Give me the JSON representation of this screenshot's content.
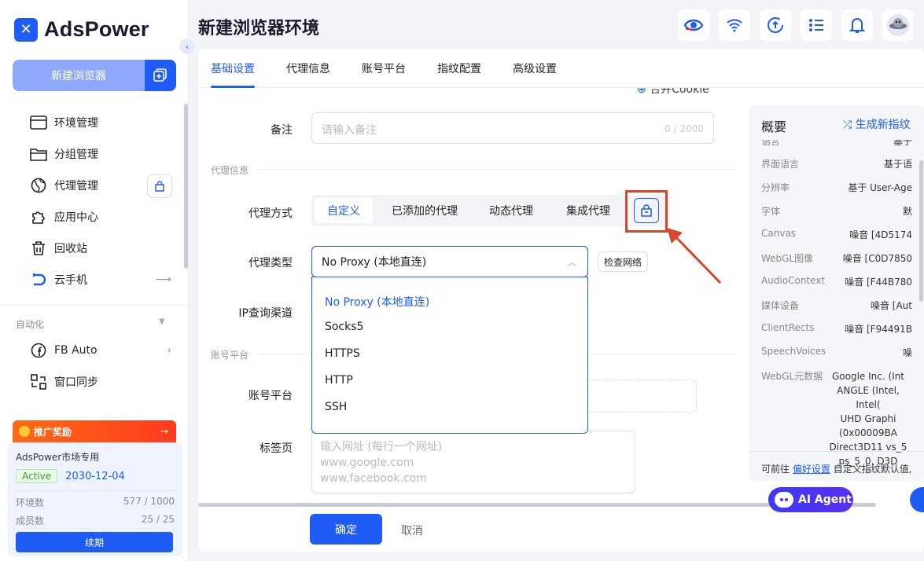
{
  "app": {
    "name": "AdsPower",
    "logo_letter": "✕"
  },
  "sidebar": {
    "new_browser_label": "新建浏览器",
    "items": [
      {
        "label": "环境管理",
        "icon": "browser-window-icon"
      },
      {
        "label": "分组管理",
        "icon": "folder-icon"
      },
      {
        "label": "代理管理",
        "icon": "globe-icon"
      },
      {
        "label": "应用中心",
        "icon": "puzzle-icon"
      },
      {
        "label": "回收站",
        "icon": "trash-icon"
      },
      {
        "label": "云手机",
        "icon": "cloud-phone-icon"
      }
    ],
    "automation_label": "自动化",
    "automation_items": [
      {
        "label": "FB Auto",
        "icon": "facebook-icon"
      },
      {
        "label": "窗口同步",
        "icon": "window-sync-icon"
      }
    ],
    "promo": {
      "header": "推广奖励",
      "title": "AdsPower市场专用",
      "status": "Active",
      "expiry": "2030-12-04",
      "env_label": "环境数",
      "env_value": "577 / 1000",
      "member_label": "成员数",
      "member_value": "25 / 25",
      "renew_label": "续期"
    }
  },
  "header": {
    "title": "新建浏览器环境"
  },
  "tabs": [
    {
      "label": "基础设置",
      "active": true
    },
    {
      "label": "代理信息",
      "active": false
    },
    {
      "label": "账号平台",
      "active": false
    },
    {
      "label": "指纹配置",
      "active": false
    },
    {
      "label": "高级设置",
      "active": false
    }
  ],
  "form": {
    "import_cookie": "合并Cookie",
    "remark_label": "备注",
    "remark_placeholder": "请输入备注",
    "remark_counter": "0 / 2000",
    "proxy_section": "代理信息",
    "proxy_method_label": "代理方式",
    "proxy_methods": [
      "自定义",
      "已添加的代理",
      "动态代理",
      "集成代理"
    ],
    "proxy_type_label": "代理类型",
    "proxy_type_value": "No Proxy (本地直连)",
    "check_network": "检查网络",
    "ip_channel_label": "IP查询渠道",
    "proxy_options": [
      "No Proxy (本地直连)",
      "Socks5",
      "HTTPS",
      "HTTP",
      "SSH"
    ],
    "account_section": "账号平台",
    "account_platform_label": "账号平台",
    "tabs_label": "标签页",
    "tabs_placeholder": [
      "输入网址 (每行一个网址)",
      "www.google.com",
      "www.facebook.com"
    ],
    "ok_label": "确定",
    "cancel_label": "取消"
  },
  "overview": {
    "title": "概要",
    "generate": "生成新指纹",
    "rows": [
      {
        "k": "语言",
        "v": "基于"
      },
      {
        "k": "界面语言",
        "v": "基于语"
      },
      {
        "k": "分辨率",
        "v": "基于 User-Age"
      },
      {
        "k": "字体",
        "v": "默"
      },
      {
        "k": "Canvas",
        "v": "噪音 [4D5174"
      },
      {
        "k": "WebGL图像",
        "v": "噪音 [C0D7850"
      },
      {
        "k": "AudioContext",
        "v": "噪音 [F44B780"
      },
      {
        "k": "媒体设备",
        "v": "噪音 [Aut"
      },
      {
        "k": "ClientRects",
        "v": "噪音 [F94491B"
      },
      {
        "k": "SpeechVoices",
        "v": "噪"
      }
    ],
    "webgl_label": "WebGL元数据",
    "webgl_lines": [
      "Google Inc. (Int",
      "ANGLE (Intel, Intel(",
      "UHD Graphi",
      "(0x00009BA",
      "Direct3D11 vs_5",
      "ps_5_0, D3D"
    ],
    "footer_pre": "可前往",
    "footer_link": "偏好设置",
    "footer_post": "自定义指纹默认值,"
  },
  "ai_agent": "AI Agent",
  "colors": {
    "accent": "#1f5cf5",
    "highlight": "#d9472b",
    "promo": "#ff5a1f"
  }
}
